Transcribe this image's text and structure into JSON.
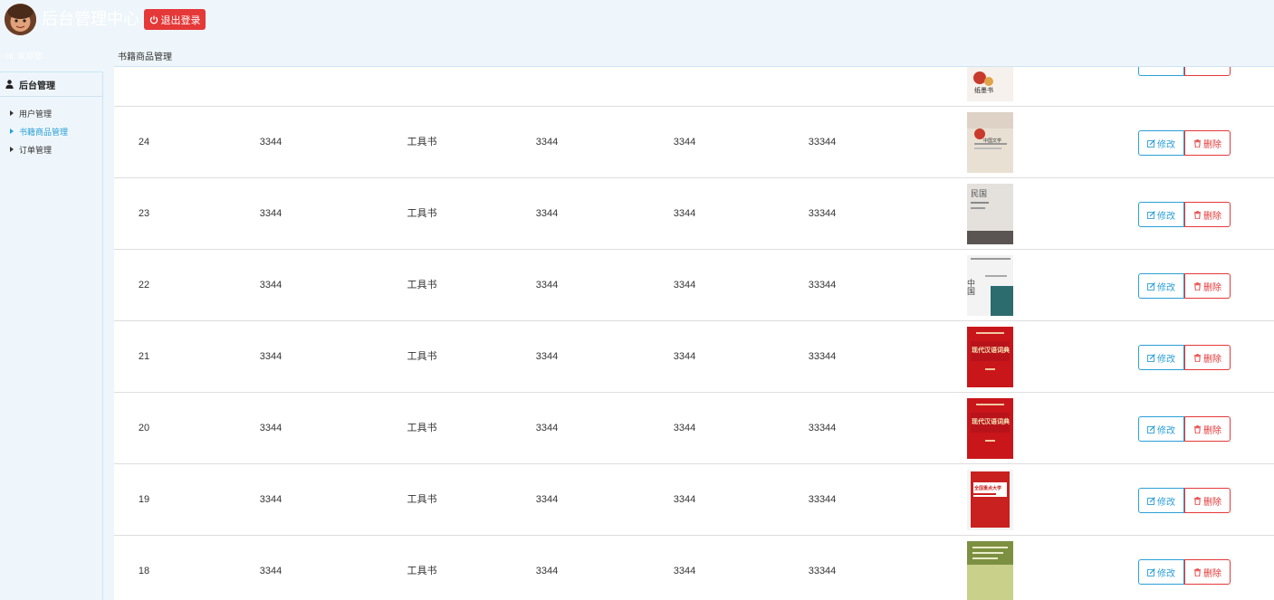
{
  "header": {
    "title": "后台管理中心",
    "logout_label": "退出登录",
    "colors": {
      "logout_bg": "#e53838"
    }
  },
  "subheader": {
    "welcome": "Hi, 欢迎您",
    "breadcrumb": "书籍商品管理"
  },
  "sidebar": {
    "heading": "后台管理",
    "items": [
      {
        "label": "用户管理",
        "active": false
      },
      {
        "label": "书籍商品管理",
        "active": true
      },
      {
        "label": "订单管理",
        "active": false
      }
    ]
  },
  "table": {
    "partial_top_cover_text": "纸墨书",
    "rows": [
      {
        "id": "24",
        "a": "3344",
        "category": "工具书",
        "b": "3344",
        "c": "3344",
        "d": "33344",
        "cover_text": "中国文学",
        "cover_style": "beige-red"
      },
      {
        "id": "23",
        "a": "3344",
        "category": "工具书",
        "b": "3344",
        "c": "3344",
        "d": "33344",
        "cover_text": "民国",
        "cover_style": "grey"
      },
      {
        "id": "22",
        "a": "3344",
        "category": "工具书",
        "b": "3344",
        "c": "3344",
        "d": "33344",
        "cover_text": "中国",
        "cover_style": "teal"
      },
      {
        "id": "21",
        "a": "3344",
        "category": "工具书",
        "b": "3344",
        "c": "3344",
        "d": "33344",
        "cover_text": "现代汉语词典",
        "cover_style": "red"
      },
      {
        "id": "20",
        "a": "3344",
        "category": "工具书",
        "b": "3344",
        "c": "3344",
        "d": "33344",
        "cover_text": "现代汉语词典",
        "cover_style": "red"
      },
      {
        "id": "19",
        "a": "3344",
        "category": "工具书",
        "b": "3344",
        "c": "3344",
        "d": "33344",
        "cover_text": "全国重点大学",
        "cover_style": "red-white"
      },
      {
        "id": "18",
        "a": "3344",
        "category": "工具书",
        "b": "3344",
        "c": "3344",
        "d": "33344",
        "cover_text": "",
        "cover_style": "green"
      }
    ],
    "edit_label": "修改",
    "delete_label": "删除"
  }
}
